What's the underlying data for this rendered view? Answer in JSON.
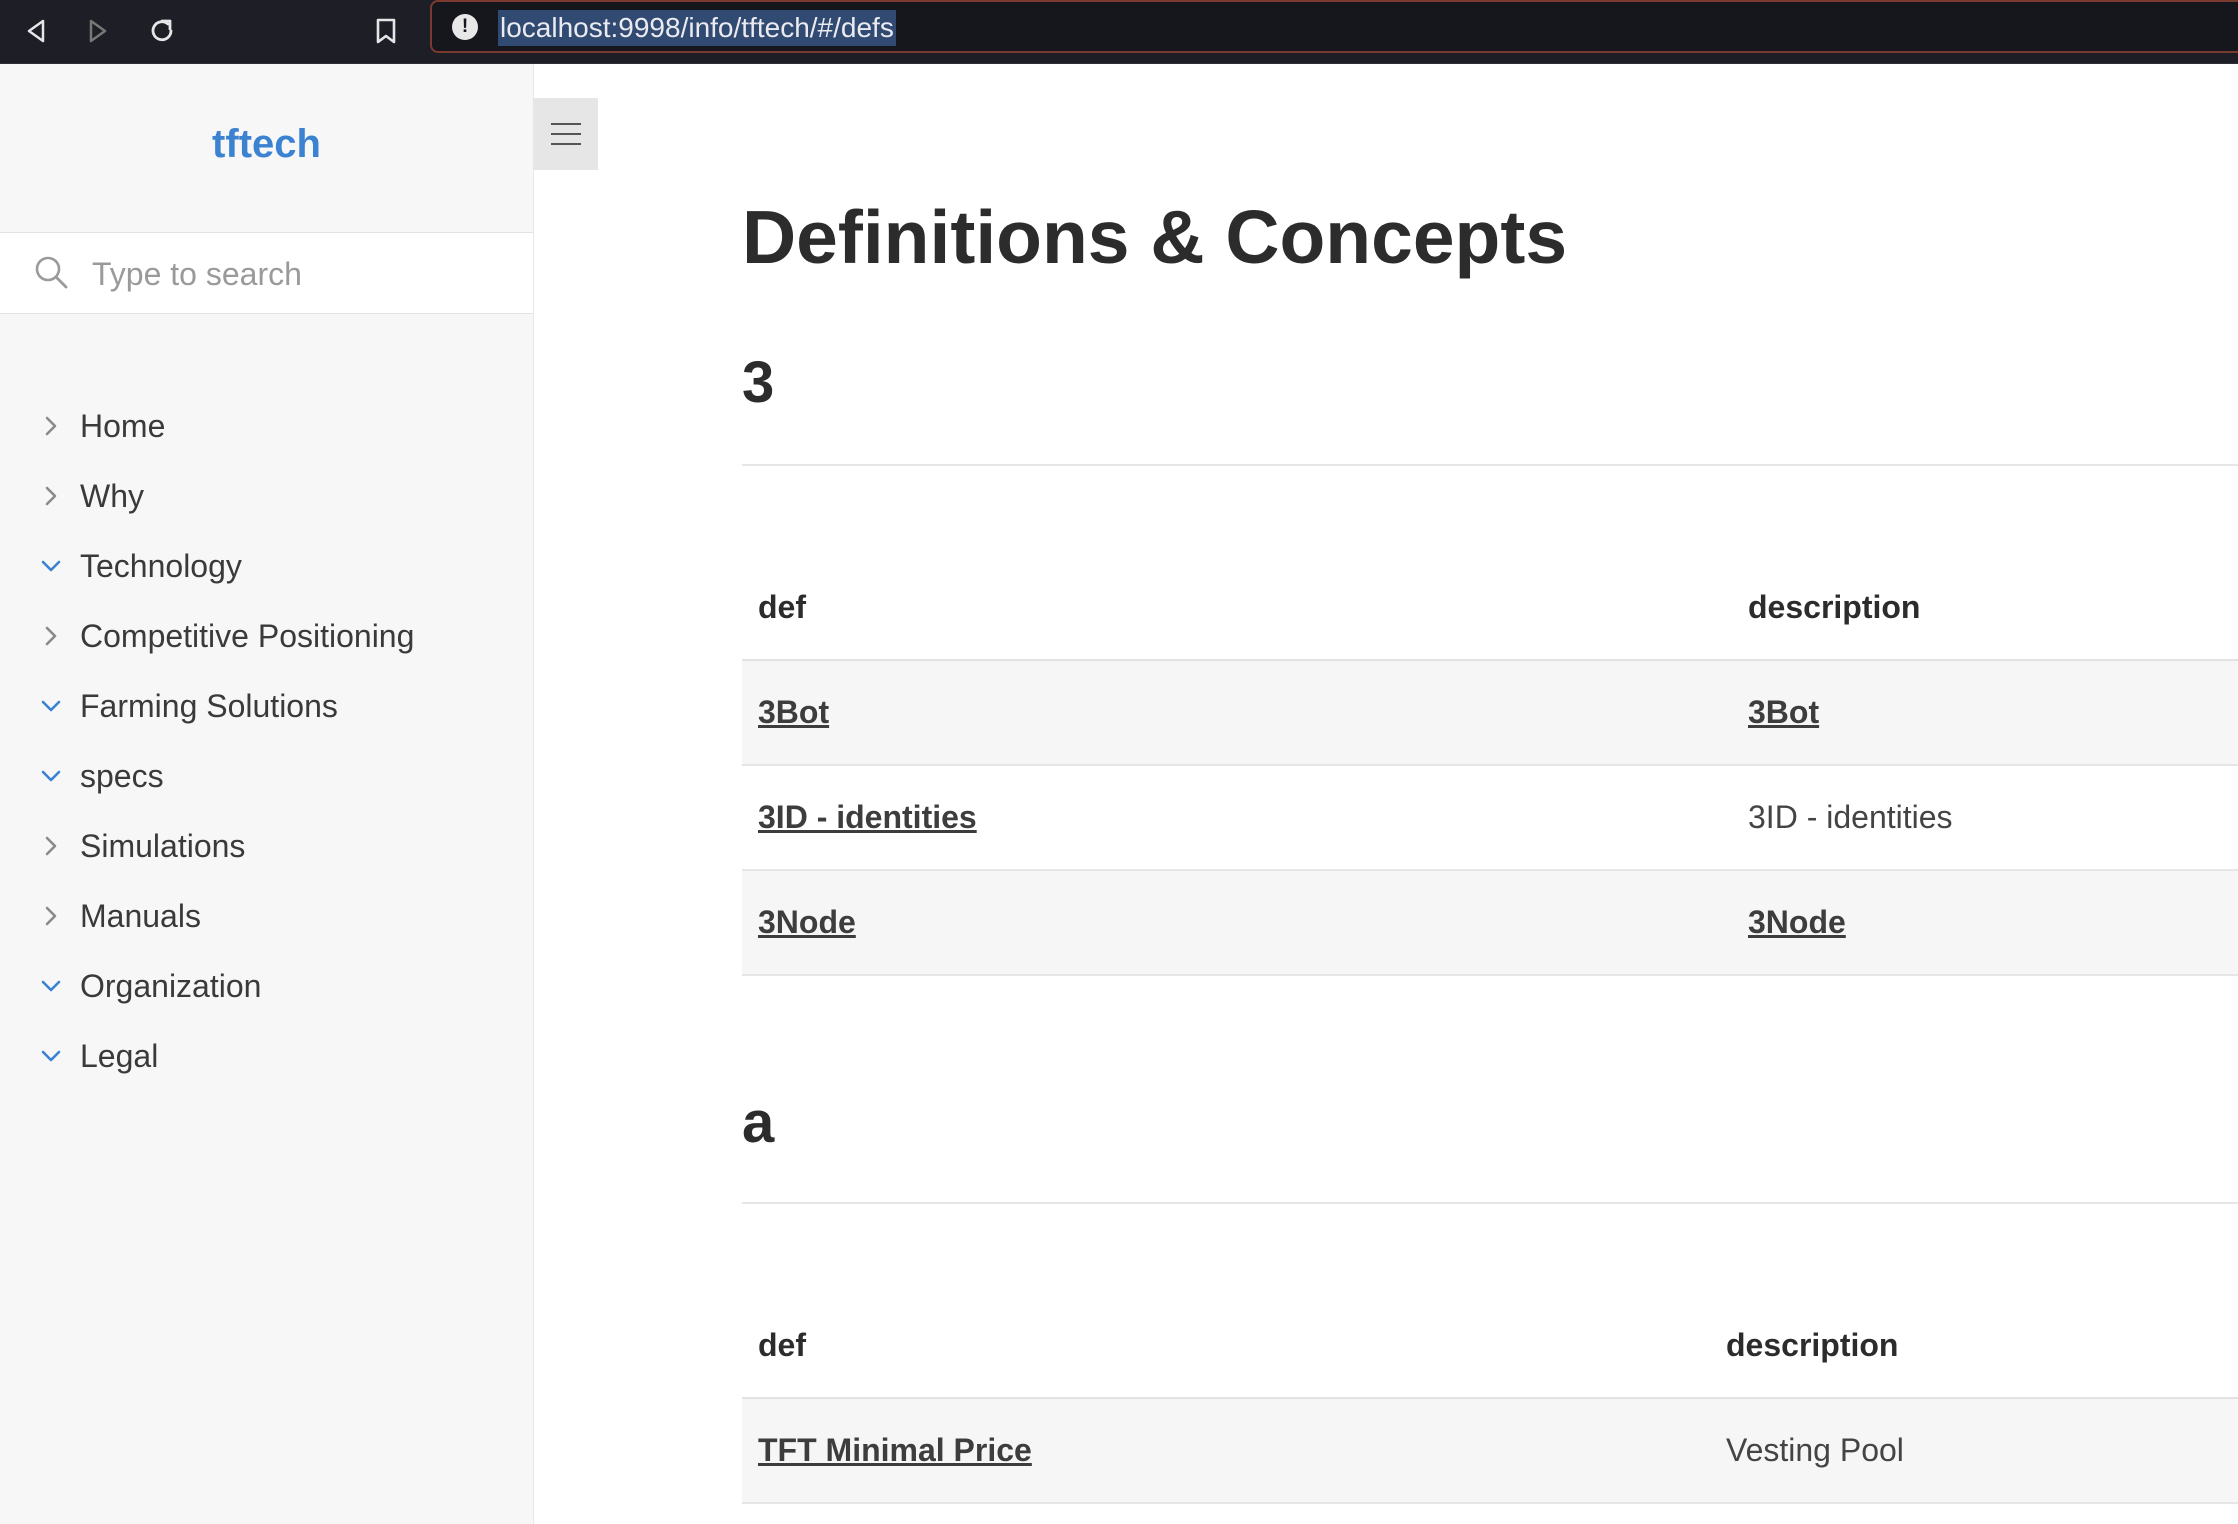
{
  "browser": {
    "url": "localhost:9998/info/tftech/#/defs"
  },
  "sidebar": {
    "app_name": "tftech",
    "search_placeholder": "Type to search",
    "items": [
      {
        "label": "Home",
        "expanded": false
      },
      {
        "label": "Why",
        "expanded": false
      },
      {
        "label": "Technology",
        "expanded": true
      },
      {
        "label": "Competitive Positioning",
        "expanded": false
      },
      {
        "label": "Farming Solutions",
        "expanded": true
      },
      {
        "label": "specs",
        "expanded": true
      },
      {
        "label": "Simulations",
        "expanded": false
      },
      {
        "label": "Manuals",
        "expanded": false
      },
      {
        "label": "Organization",
        "expanded": true
      },
      {
        "label": "Legal",
        "expanded": true
      }
    ]
  },
  "main": {
    "title": "Definitions & Concepts",
    "sections": [
      {
        "heading": "3",
        "col_def": "def",
        "col_desc": "description",
        "rows": [
          {
            "def": "3Bot",
            "desc": "3Bot",
            "desc_link": true
          },
          {
            "def": "3ID - identities",
            "desc": "3ID - identities",
            "desc_link": false
          },
          {
            "def": "3Node",
            "desc": "3Node",
            "desc_link": true
          }
        ]
      },
      {
        "heading": "a",
        "col_def": "def",
        "col_desc": "description",
        "rows": [
          {
            "def": "TFT Minimal Price",
            "desc": "Vesting Pool",
            "desc_link": false
          }
        ]
      }
    ]
  },
  "colors": {
    "accent": "#3b82d1",
    "topbar": "#1e1f26",
    "sidebar_bg": "#f7f7f7"
  }
}
